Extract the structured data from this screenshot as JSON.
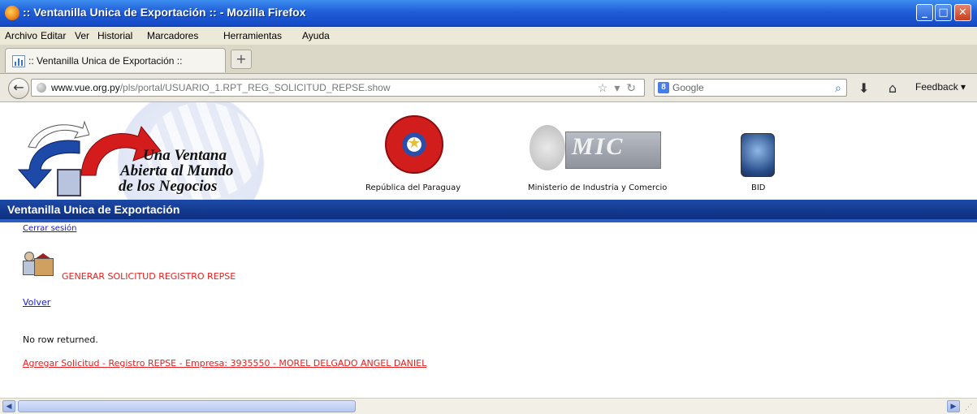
{
  "window": {
    "title": ":: Ventanilla Unica de Exportación :: - Mozilla Firefox",
    "controls": [
      "minimize-icon",
      "maximize-icon",
      "close-icon"
    ]
  },
  "menu": {
    "items": [
      "Archivo",
      "Editar",
      "Ver",
      "Historial",
      "Marcadores",
      "Herramientas",
      "Ayuda"
    ]
  },
  "tabs": {
    "items": [
      {
        "label": ":: Ventanilla Unica de Exportación ::"
      }
    ],
    "new_tab_label": "+"
  },
  "nav": {
    "url_domain": "www.vue.org.py",
    "url_path": "/pls/portal/USUARIO_1.RPT_REG_SOLICITUD_REPSE.show",
    "search_engine": "Google",
    "feedback_label": "Feedback"
  },
  "banner": {
    "slogan": [
      "Una Ventana",
      "Abierta al Mundo",
      "de los Negocios"
    ],
    "logos": [
      {
        "caption": "República del Paraguay"
      },
      {
        "caption": "Ministerio de Industria y Comercio",
        "mark": "MIC"
      },
      {
        "caption": "BID"
      }
    ]
  },
  "header_bar": {
    "title": "Ventanilla Unica de Exportación",
    "color": "#0d2e7e"
  },
  "content": {
    "logout_link": "Cerrar sesión",
    "page_heading": "GENERAR SOLICITUD REGISTRO REPSE",
    "back_link": "Volver",
    "status_text": "No row returned.",
    "add_request_link": "Agregar Solicitud - Registro REPSE - Empresa: 3935550 - MOREL DELGADO ANGEL DANIEL"
  },
  "colors": {
    "accent_red": "#e62020",
    "link_blue": "#1a1ad0",
    "title_bar": "#1f5ed8"
  }
}
